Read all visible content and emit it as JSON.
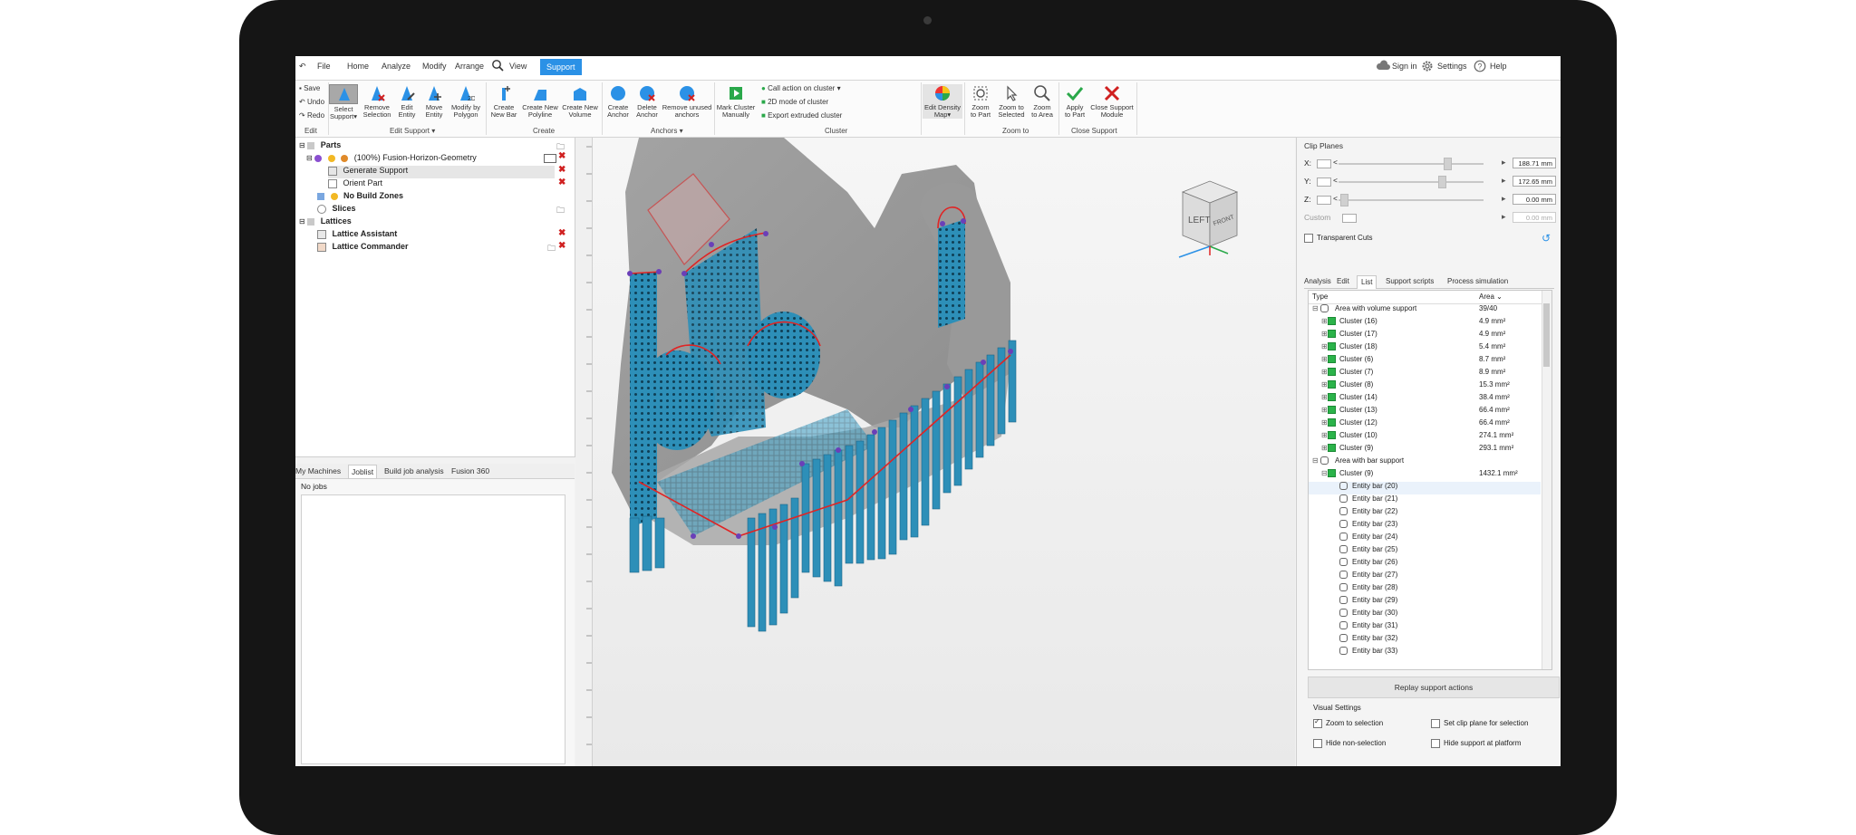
{
  "menu": {
    "file": "File",
    "tabs": [
      "Home",
      "Analyze",
      "Modify",
      "Arrange",
      "View"
    ],
    "active_tab": "Support",
    "sign_in": "Sign in",
    "settings": "Settings",
    "help": "Help"
  },
  "ribbon": {
    "edit": {
      "save": "Save",
      "undo": "Undo",
      "redo": "Redo",
      "label": "Edit"
    },
    "edit_support": {
      "tools": [
        [
          "Select",
          "Support▾"
        ],
        [
          "Remove",
          "Selection"
        ],
        [
          "Edit",
          "Entity"
        ],
        [
          "Move",
          "Entity"
        ],
        [
          "Modify by",
          "Polygon"
        ]
      ],
      "label": "Edit Support ▾"
    },
    "create": {
      "tools": [
        [
          "Create",
          "New Bar"
        ],
        [
          "Create New",
          "Polyline"
        ],
        [
          "Create New",
          "Volume"
        ]
      ],
      "label": "Create"
    },
    "anchors": {
      "tools": [
        [
          "Create",
          "Anchor"
        ],
        [
          "Delete",
          "Anchor"
        ],
        [
          "Remove unused",
          "anchors"
        ]
      ],
      "label": "Anchors ▾"
    },
    "cluster": {
      "tool": [
        "Mark Cluster",
        "Manually"
      ],
      "call_action": "Call action on cluster",
      "mode_2d": "2D mode of cluster",
      "export": "Export extruded cluster",
      "label": "Cluster"
    },
    "density": [
      "Edit Density",
      "Map▾"
    ],
    "zoom": {
      "tools": [
        [
          "Zoom",
          "to Part"
        ],
        [
          "Zoom to",
          "Selected"
        ],
        [
          "Zoom",
          "to Area"
        ]
      ],
      "label": "Zoom to"
    },
    "close": {
      "tools": [
        [
          "Apply",
          "to Part"
        ],
        [
          "Close Support",
          "Module"
        ]
      ],
      "label": "Close Support"
    }
  },
  "tree": {
    "parts": "Parts",
    "part_name": "(100%) Fusion-Horizon-Geometry",
    "generate_support": "Generate Support",
    "orient_part": "Orient Part",
    "no_build_zones": "No Build Zones",
    "slices": "Slices",
    "lattices": "Lattices",
    "lattice_assistant": "Lattice Assistant",
    "lattice_commander": "Lattice Commander"
  },
  "bottom_tabs": [
    "My Machines",
    "Joblist",
    "Build job analysis",
    "Fusion 360"
  ],
  "jobs": {
    "empty": "No jobs"
  },
  "viewcube": {
    "left": "LEFT",
    "front": "FRONT"
  },
  "clip": {
    "title": "Clip Planes",
    "rows": [
      {
        "axis": "X:",
        "value": "188.71 mm"
      },
      {
        "axis": "Y:",
        "value": "172.65 mm"
      },
      {
        "axis": "Z:",
        "value": "0.00 mm"
      }
    ],
    "custom": "Custom",
    "custom_value": "0.00 mm",
    "transparent_cuts": "Transparent Cuts"
  },
  "right_tabs": [
    "Analysis",
    "Edit",
    "List",
    "Support scripts",
    "Process simulation"
  ],
  "list": {
    "col_type": "Type",
    "col_area": "Area",
    "volume_group": "Area with volume support",
    "volume_area": "39/40",
    "clusters": [
      {
        "name": "Cluster (16)",
        "area": "4.9 mm²"
      },
      {
        "name": "Cluster (17)",
        "area": "4.9 mm²"
      },
      {
        "name": "Cluster (18)",
        "area": "5.4 mm²"
      },
      {
        "name": "Cluster (6)",
        "area": "8.7 mm²"
      },
      {
        "name": "Cluster (7)",
        "area": "8.9 mm²"
      },
      {
        "name": "Cluster (8)",
        "area": "15.3 mm²"
      },
      {
        "name": "Cluster (14)",
        "area": "38.4 mm²"
      },
      {
        "name": "Cluster (13)",
        "area": "66.4 mm²"
      },
      {
        "name": "Cluster (12)",
        "area": "66.4 mm²"
      },
      {
        "name": "Cluster (10)",
        "area": "274.1 mm²"
      },
      {
        "name": "Cluster (9)",
        "area": "293.1 mm²"
      }
    ],
    "bar_group": "Area with bar support",
    "bar_cluster": {
      "name": "Cluster (9)",
      "area": "1432.1 mm²"
    },
    "bars": [
      "Entity bar (20)",
      "Entity bar (21)",
      "Entity bar (22)",
      "Entity bar (23)",
      "Entity bar (24)",
      "Entity bar (25)",
      "Entity bar (26)",
      "Entity bar (27)",
      "Entity bar (28)",
      "Entity bar (29)",
      "Entity bar (30)",
      "Entity bar (31)",
      "Entity bar (32)",
      "Entity bar (33)"
    ]
  },
  "replay": "Replay support actions",
  "visual": {
    "title": "Visual Settings",
    "zoom_to_selection": "Zoom to selection",
    "set_clip_plane": "Set clip plane for selection",
    "hide_non_selection": "Hide non-selection",
    "hide_support_platform": "Hide support at platform"
  },
  "colors": {
    "accent": "#2b91e6",
    "support": "#2d8fb8",
    "part": "#9a9a9a",
    "edge": "#e02424",
    "anchor": "#6a3fb8"
  }
}
